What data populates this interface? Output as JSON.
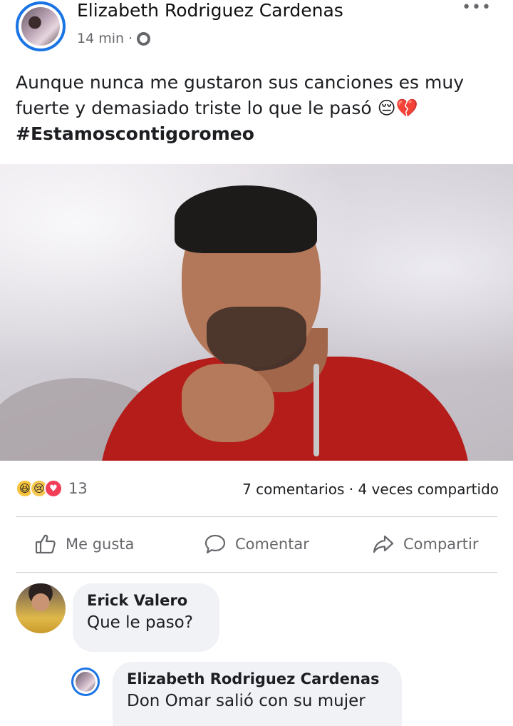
{
  "post": {
    "author": "Elizabeth Rodriguez Cardenas",
    "time": "14 min",
    "separator": "·",
    "more_label": "•••",
    "text_line": "Aunque nunca me gustaron sus canciones es muy fuerte y demasiado triste lo que le pasó 😔💔",
    "hashtag": "#Estamoscontigoromeo"
  },
  "reactions": {
    "icons": [
      "haha-reaction-icon",
      "sad-reaction-icon",
      "love-reaction-icon"
    ],
    "count": "13",
    "stats": "7 comentarios · 4 veces compartido"
  },
  "actions": {
    "like": "Me gusta",
    "comment": "Comentar",
    "share": "Compartir"
  },
  "comments": [
    {
      "name": "Erick Valero",
      "text": "Que le paso?"
    },
    {
      "name": "Elizabeth Rodriguez Cardenas",
      "text": "Don Omar salió con su mujer"
    }
  ],
  "colors": {
    "accent": "#1b74e4",
    "muted": "#65676b",
    "bubble": "#f0f2f5",
    "shirt": "#b51d1a"
  }
}
